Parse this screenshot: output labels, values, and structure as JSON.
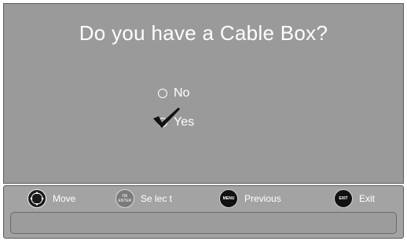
{
  "screen": {
    "question": "Do you have a Cable Box?",
    "options": [
      {
        "label": "No",
        "selected": false
      },
      {
        "label": "Yes",
        "selected": true
      }
    ]
  },
  "legend": {
    "move_label": "Move",
    "select_label": "Se lec t",
    "ok_icon_top": "OK",
    "ok_icon_bottom": "ENTER",
    "previous_label": "Previous",
    "menu_icon_text": "MENU",
    "exit_label": "Exit",
    "exit_icon_text": "EXIT"
  },
  "colors": {
    "screen_bg": "#9a9a9a",
    "text": "#ffffff",
    "button_dark": "#111111"
  }
}
